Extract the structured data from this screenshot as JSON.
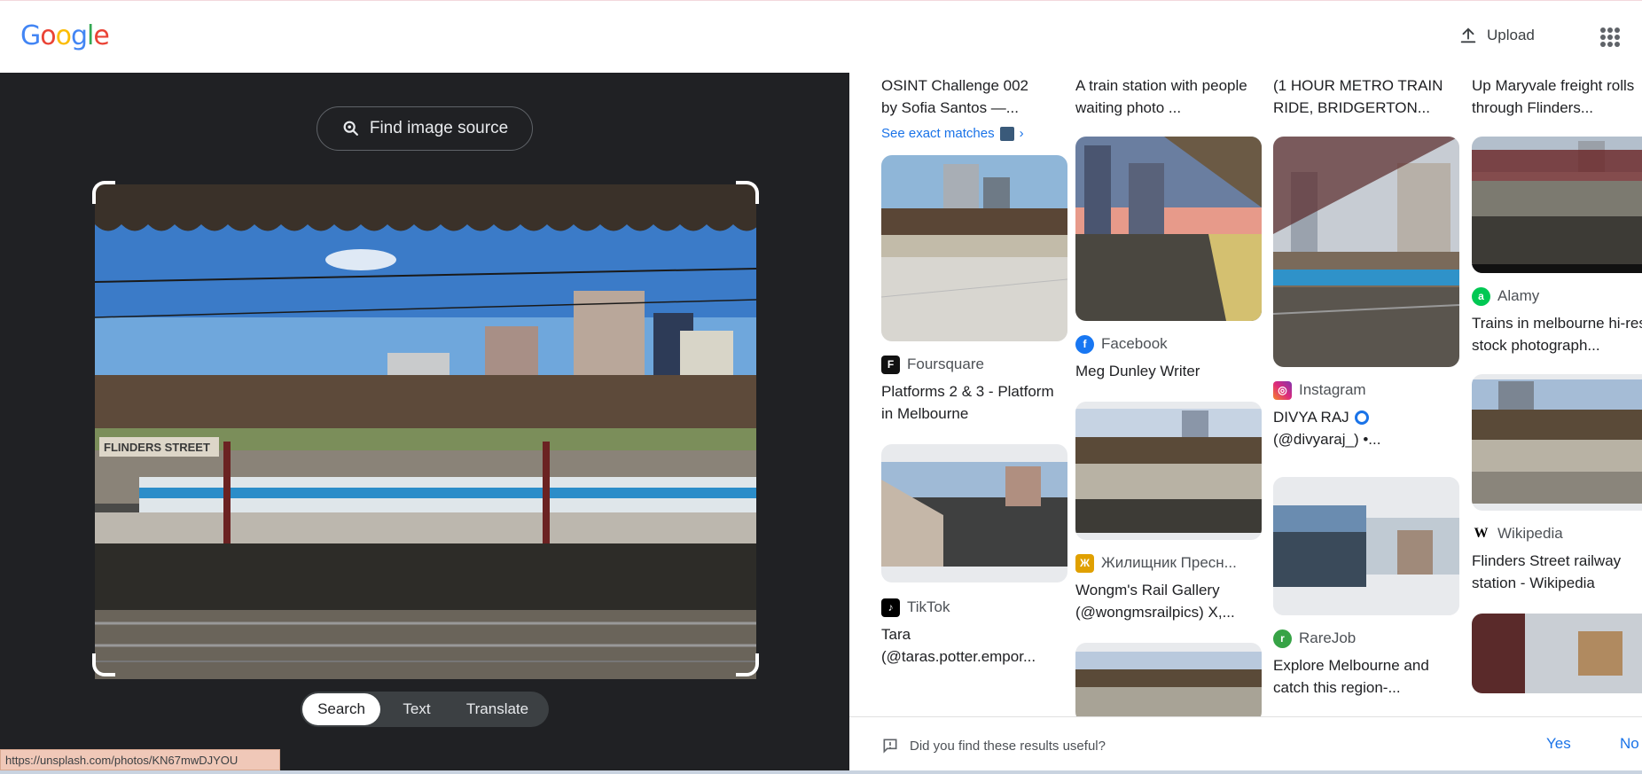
{
  "header": {
    "logo": "Google",
    "upload_label": "Upload"
  },
  "lens": {
    "find_source_label": "Find image source",
    "modes": [
      "Search",
      "Text",
      "Translate"
    ],
    "station_sign": "FLINDERS STREET",
    "status_url": "https://unsplash.com/photos/KN67mwDJYOU"
  },
  "results": {
    "col1": {
      "top_title": "OSINT Challenge 002 by Sofia Santos —...",
      "see_exact": "See exact matches",
      "card1_source": "Foursquare",
      "card1_title": "Platforms 2 & 3 - Platform in Melbourne",
      "card2_source": "TikTok",
      "card2_title": "Tara (@taras.potter.empor..."
    },
    "col2": {
      "top_title": "A train station with people waiting photo ...",
      "card1_source": "Facebook",
      "card1_title": "Meg Dunley Writer",
      "card2_source": "Жилищник Пресн...",
      "card2_title": "Wongm's Rail Gallery (@wongmsrailpics) X,..."
    },
    "col3": {
      "top_title": "(1 HOUR METRO TRAIN RIDE, BRIDGERTON...",
      "card1_source": "Instagram",
      "card1_title": "DIVYA RAJ",
      "card1_title2": "(@divyaraj_) •...",
      "card2_source": "RareJob",
      "card2_title": "Explore Melbourne and catch this region-..."
    },
    "col4": {
      "top_title": "Up Maryvale freight rolls through Flinders...",
      "card1_source": "Alamy",
      "card1_title": "Trains in melbourne hi-res stock photograph...",
      "card2_source": "Wikipedia",
      "card2_title": "Flinders Street railway station - Wikipedia"
    }
  },
  "feedback": {
    "question": "Did you find these results useful?",
    "yes": "Yes",
    "no": "No"
  },
  "colors": {
    "blue": "#1a73e8",
    "dark_panel": "#202124"
  }
}
